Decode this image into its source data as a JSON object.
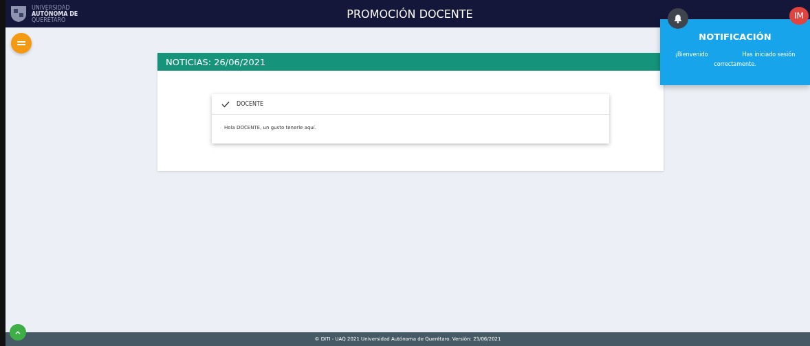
{
  "header": {
    "logo_lines": [
      "UNIVERSIDAD",
      "AUTÓNOMA DE",
      "QUERÉTARO"
    ],
    "title": "PROMOCIÓN DOCENTE",
    "avatar": "IM"
  },
  "notification": {
    "title": "NOTIFICACIÓN",
    "greeting": "¡Bienvenido",
    "message": "Has iniciado sesión correctamente."
  },
  "news": {
    "title": "NOTICIAS: 26/06/2021",
    "items": [
      {
        "title": "DOCENTE",
        "body": "Hola DOCENTE, un gusto tenerle aquí."
      }
    ]
  },
  "footer": "© DITI - UAQ 2021 Universidad Autónoma de Querétaro. Versión: 23/06/2021"
}
